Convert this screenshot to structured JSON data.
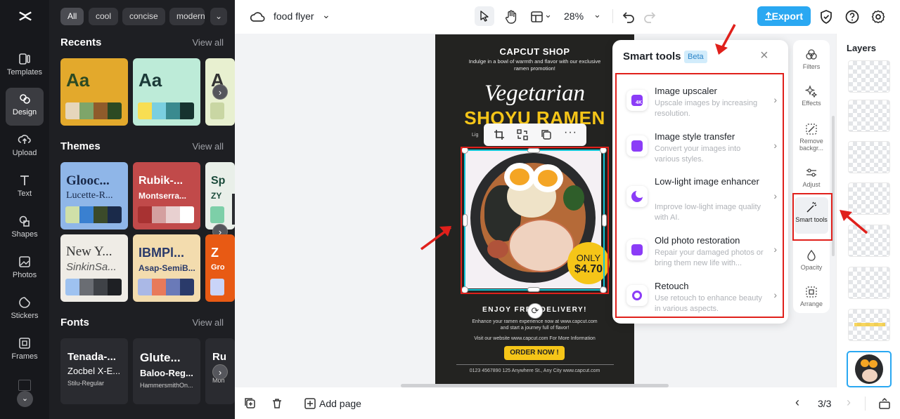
{
  "rail": {
    "items": [
      {
        "label": "Templates",
        "icon": "templates-icon"
      },
      {
        "label": "Design",
        "icon": "design-icon"
      },
      {
        "label": "Upload",
        "icon": "upload-icon"
      },
      {
        "label": "Text",
        "icon": "text-icon"
      },
      {
        "label": "Shapes",
        "icon": "shapes-icon"
      },
      {
        "label": "Photos",
        "icon": "photos-icon"
      },
      {
        "label": "Stickers",
        "icon": "stickers-icon"
      },
      {
        "label": "Frames",
        "icon": "frames-icon"
      }
    ]
  },
  "panel": {
    "chips": [
      "All",
      "cool",
      "concise",
      "modern"
    ],
    "recents": {
      "title": "Recents",
      "view_all": "View all",
      "cards": [
        {
          "h": "Aa"
        },
        {
          "h": "Aa"
        },
        {
          "h": "A"
        }
      ]
    },
    "themes": {
      "title": "Themes",
      "view_all": "View all",
      "cards": [
        {
          "h": "Glooc...",
          "s": "Lucette-R..."
        },
        {
          "h": "Rubik-...",
          "s": "Montserra..."
        },
        {
          "h": "Sp",
          "s": "ZY"
        },
        {
          "h": "New Y...",
          "s": "SinkinSa..."
        },
        {
          "h": "IBMPl...",
          "s": "Asap-SemiB..."
        },
        {
          "h": "Z",
          "s": "Gro"
        }
      ]
    },
    "fonts": {
      "title": "Fonts",
      "view_all": "View all",
      "cards": [
        {
          "a": "Tenada-...",
          "b": "Zocbel X-E...",
          "c": "Stilu-Regular"
        },
        {
          "a": "Glute...",
          "b": "Baloo-Reg...",
          "c": "HammersmithOn..."
        },
        {
          "a": "Ru",
          "b": "",
          "c": "Mon"
        }
      ]
    }
  },
  "topbar": {
    "project_name": "food flyer",
    "zoom": "28%",
    "export_label": "Export"
  },
  "flyer": {
    "shop": "CAPCUT SHOP",
    "tagline1": "Indulge in a bowl of warmth and flavor with our exclusive",
    "tagline2": "ramen promotion!",
    "script_title": "Vegetarian",
    "main_title": "SHOYU RAMEN",
    "price_top": "ONLY",
    "price": "$4.70",
    "delivery": "ENJOY FREE DELIVERY!",
    "body1": "Enhance your ramen experience now at www.capcut.com",
    "body2": "and start a journey full of flavor!",
    "body3": "Visit our website www.capcut.com For More Information",
    "cta": "ORDER NOW !",
    "footer": "0123 4567890   125 Anywhere St., Any City   www.capcut.com"
  },
  "smart_tools": {
    "title": "Smart tools",
    "badge": "Beta",
    "items": [
      {
        "title": "Image upscaler",
        "desc": "Upscale images by increasing resolution.",
        "icon": "upscale-icon"
      },
      {
        "title": "Image style transfer",
        "desc": "Convert your images into various styles.",
        "icon": "style-transfer-icon"
      },
      {
        "title": "Low-light image enhancer",
        "desc": "Improve low-light image quality with AI.",
        "icon": "low-light-icon"
      },
      {
        "title": "Old photo restoration",
        "desc": "Repair your damaged photos or bring them new life with...",
        "icon": "restore-icon"
      },
      {
        "title": "Retouch",
        "desc": "Use retouch to enhance beauty in various aspects.",
        "icon": "retouch-icon"
      }
    ]
  },
  "tool_rail": {
    "items": [
      {
        "label": "Filters"
      },
      {
        "label": "Effects"
      },
      {
        "label": "Remove backgr..."
      },
      {
        "label": "Adjust"
      },
      {
        "label": "Smart tools"
      },
      {
        "label": "Opacity"
      },
      {
        "label": "Arrange"
      }
    ]
  },
  "layers": {
    "title": "Layers"
  },
  "bottombar": {
    "add_page": "Add page",
    "page_indicator": "3/3"
  },
  "colors": {
    "accent": "#2aa8f2",
    "annotation_red": "#e0201b",
    "flyer_bg": "#232321",
    "title_yellow": "#f5c518",
    "smart_icon": "#8b3cf7"
  }
}
